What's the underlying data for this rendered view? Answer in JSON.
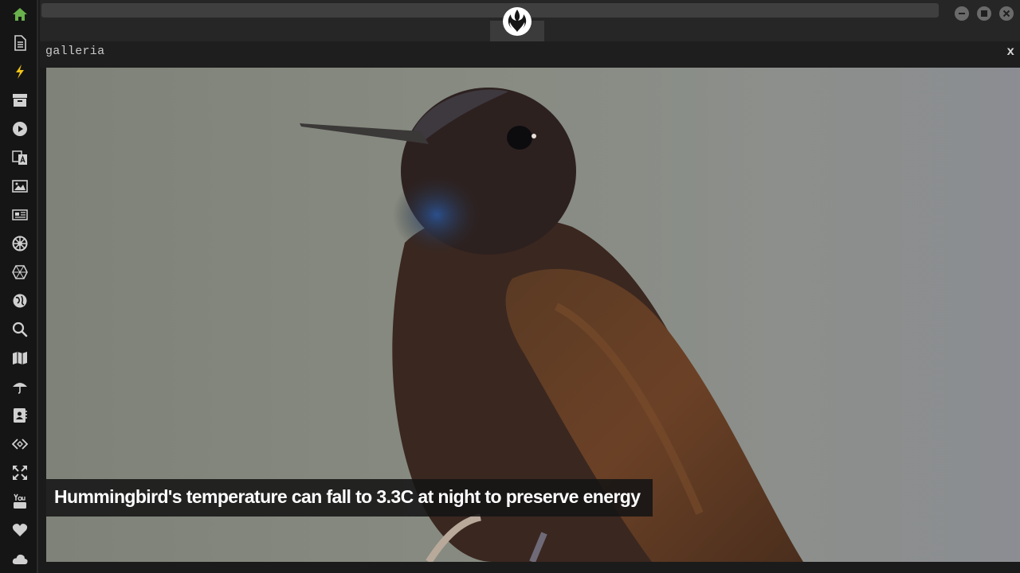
{
  "sidebar": {
    "items": [
      {
        "icon": "home-icon",
        "color": "#6ab04c"
      },
      {
        "icon": "document-icon",
        "color": "#d0d0d0"
      },
      {
        "icon": "lightning-icon",
        "color": "#f0c419"
      },
      {
        "icon": "archive-icon",
        "color": "#d0d0d0"
      },
      {
        "icon": "play-icon",
        "color": "#d0d0d0"
      },
      {
        "icon": "translate-icon",
        "color": "#d0d0d0"
      },
      {
        "icon": "image-icon",
        "color": "#d0d0d0"
      },
      {
        "icon": "newspaper-icon",
        "color": "#d0d0d0"
      },
      {
        "icon": "empire-icon",
        "color": "#d0d0d0"
      },
      {
        "icon": "hexagon-icon",
        "color": "#d0d0d0"
      },
      {
        "icon": "globe-icon",
        "color": "#d0d0d0"
      },
      {
        "icon": "search-icon",
        "color": "#d0d0d0"
      },
      {
        "icon": "map-icon",
        "color": "#d0d0d0"
      },
      {
        "icon": "umbrella-icon",
        "color": "#d0d0d0"
      },
      {
        "icon": "contacts-icon",
        "color": "#d0d0d0"
      },
      {
        "icon": "code-icon",
        "color": "#d0d0d0"
      },
      {
        "icon": "expand-icon",
        "color": "#d0d0d0"
      },
      {
        "icon": "youtube-icon",
        "color": "#d0d0d0"
      },
      {
        "icon": "heart-icon",
        "color": "#d0d0d0"
      },
      {
        "icon": "cloud-icon",
        "color": "#d0d0d0"
      }
    ]
  },
  "topbar": {
    "logo_icon": "rebel-alliance-icon",
    "window_controls": [
      "minimize-icon",
      "maximize-icon",
      "close-icon"
    ]
  },
  "panel": {
    "title": "galleria",
    "close_label": "x"
  },
  "gallery": {
    "image": "hummingbird-photo",
    "caption": "Hummingbird's temperature can fall to 3.3C at night to preserve energy"
  }
}
